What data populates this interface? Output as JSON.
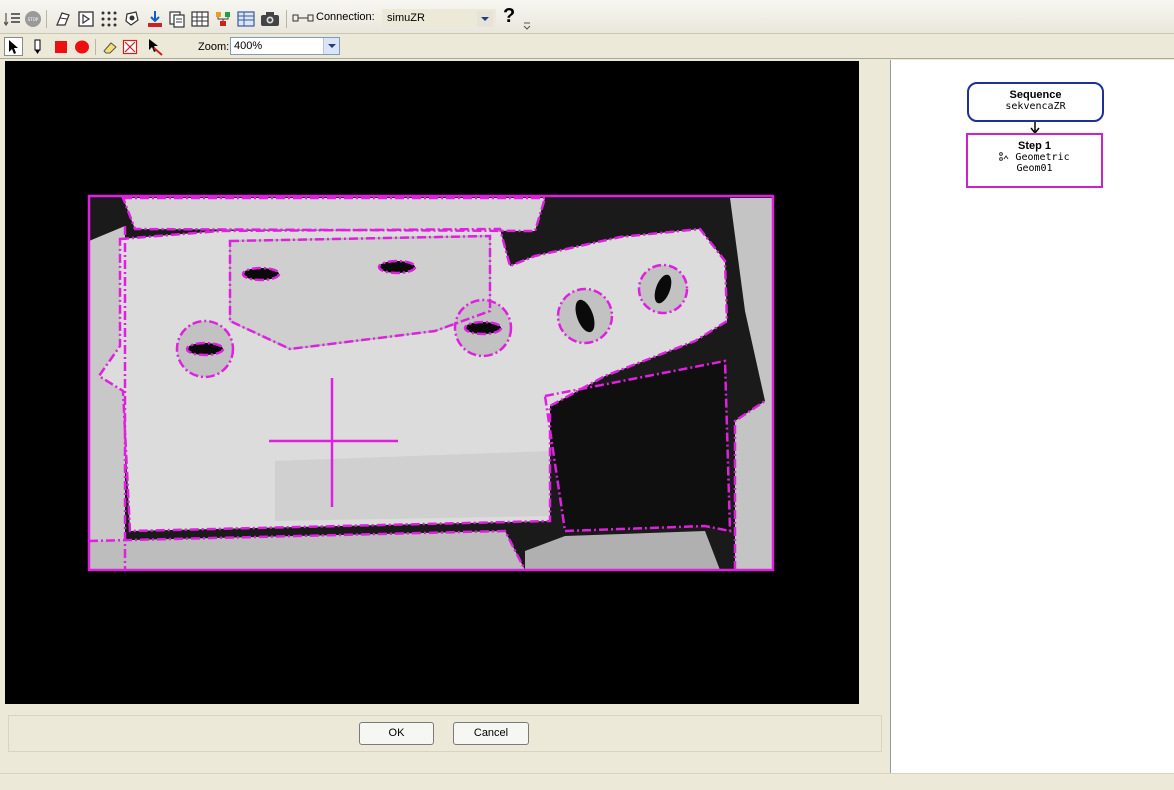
{
  "toolbar": {
    "icons": [
      "step-list-icon",
      "stop-icon",
      "tool-a-icon",
      "run-icon",
      "dots-grid-icon",
      "camera-a-icon",
      "download-icon",
      "copy-icon",
      "grid-icon",
      "tree-icon",
      "table-icon",
      "camera-icon",
      "connection-icon"
    ],
    "connection_label": "Connection:",
    "connection_value": "simuZR",
    "help_label": "?"
  },
  "drawtools": {
    "icons": [
      "pointer-icon",
      "pen-icon",
      "red-square-icon",
      "red-circle-icon",
      "eraser-icon",
      "crossed-box-icon",
      "red-pointer-icon"
    ],
    "zoom_label": "Zoom:",
    "zoom_value": "400%"
  },
  "dialog": {
    "ok_label": "OK",
    "cancel_label": "Cancel"
  },
  "sequence": {
    "title": "Sequence",
    "name": "sekvencaZR"
  },
  "step": {
    "title": "Step 1",
    "type": "Geometric",
    "name": "Geom01",
    "icon": "geometric-icon"
  },
  "colors": {
    "overlay": "#e020e0",
    "sequence_border": "#1f2f9a",
    "step_border": "#cc22cc"
  }
}
